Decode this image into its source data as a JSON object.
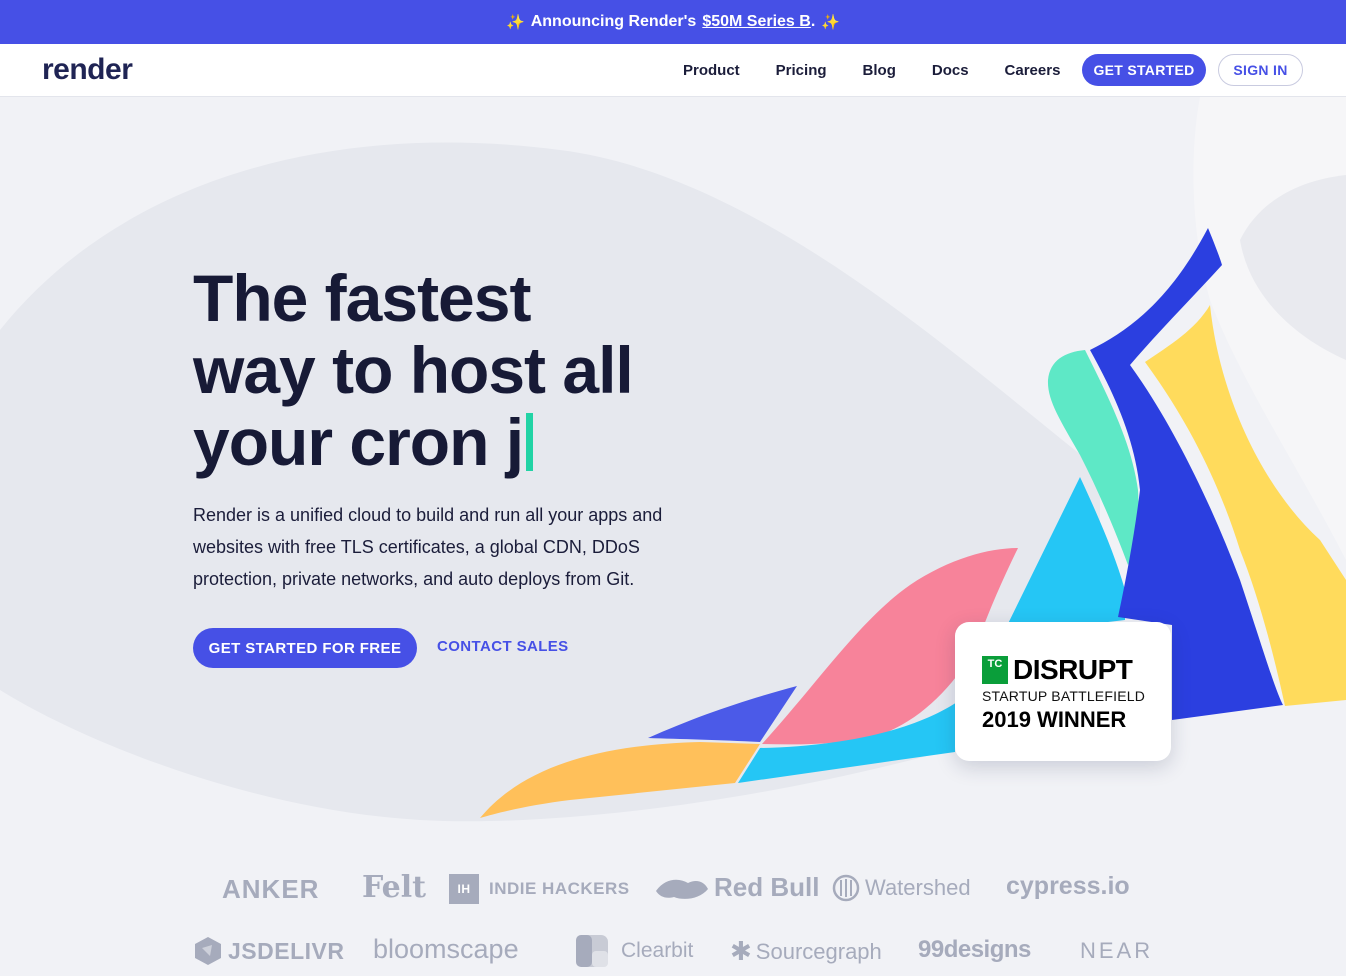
{
  "announcement": {
    "prefix": "Announcing Render's",
    "link": "$50M Series B",
    "suffix": "."
  },
  "nav": {
    "logo": "render",
    "links": [
      "Product",
      "Pricing",
      "Blog",
      "Docs",
      "Careers"
    ],
    "get_started": "GET STARTED",
    "sign_in": "SIGN IN"
  },
  "hero": {
    "headline_line1": "The fastest",
    "headline_line2": "way to host all",
    "headline_line3": "your cron j",
    "subtitle": "Render is a unified cloud to build and run all your apps and websites with free TLS certificates, a global CDN, DDoS protection, private networks, and auto deploys from Git.",
    "cta_primary": "GET STARTED FOR FREE",
    "cta_secondary": "CONTACT SALES"
  },
  "badge": {
    "tc_mark": "TC",
    "title": "DISRUPT",
    "subtitle": "STARTUP BATTLEFIELD",
    "winner": "2019 WINNER"
  },
  "customers": {
    "row1": [
      "ANKER",
      "Felt",
      "INDIE HACKERS",
      "Red Bull",
      "Watershed",
      "cypress.io"
    ],
    "row2": [
      "JSDELIVR",
      "bloomscape",
      "Clearbit",
      "Sourcegraph",
      "99designs",
      "NEAR"
    ],
    "indie_mark": "IH"
  },
  "colors": {
    "brand": "#4650e6",
    "accent_green": "#22d3a5",
    "shape_blue": "#2b3fe0",
    "shape_cyan": "#25c6f5",
    "shape_pink": "#f7839a",
    "shape_yellow": "#ffdb5c",
    "shape_orange": "#ffc05a",
    "shape_mint": "#5ee8c6"
  }
}
